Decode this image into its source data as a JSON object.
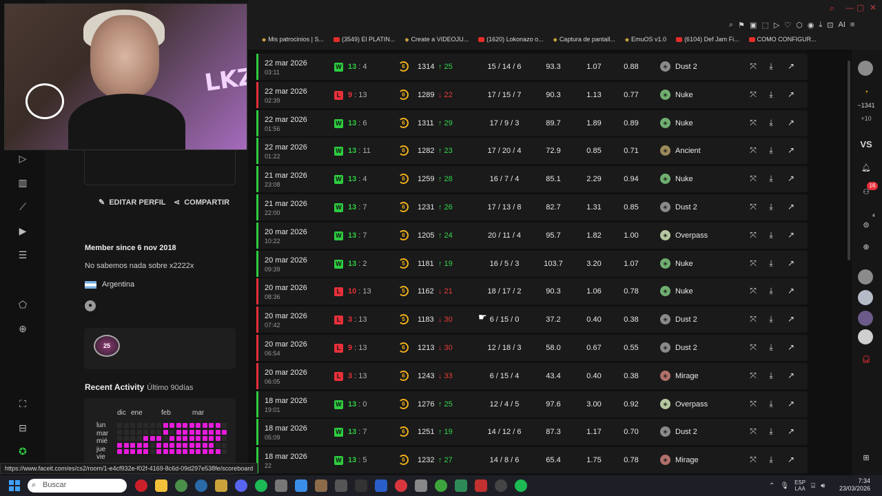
{
  "browser": {
    "bookmarks": [
      {
        "label": "Mis patrocinios | S...",
        "yt": false
      },
      {
        "label": "(3549) El PLATIN...",
        "yt": true
      },
      {
        "label": "Create a VIDEOJU...",
        "yt": false
      },
      {
        "label": "(1620) Lokonazo o...",
        "yt": true
      },
      {
        "label": "Captura de pantall...",
        "yt": false
      },
      {
        "label": "EmuOS v1.0",
        "yt": false
      },
      {
        "label": "(6104) Def Jam Fi...",
        "yt": true
      },
      {
        "label": "COMO CONFIGUR...",
        "yt": true
      }
    ],
    "ai_label": "AI",
    "status_url": "https://www.faceit.com/es/cs2/room/1-e4cf932e-f02f-4169-8c6d-09d297e538fe/scoreboard"
  },
  "profile": {
    "edit_label": "EDITAR PERFIL",
    "share_label": "COMPARTIR",
    "member_since": "Member since 6 nov 2018",
    "about": "No sabemos nada sobre x2222x",
    "country": "Argentina",
    "badge_text": "25",
    "recent_title": "Recent Activity",
    "recent_range": "Último 90días",
    "months": [
      "dic",
      "ene",
      "feb",
      "mar"
    ],
    "days": [
      "lun",
      "mar",
      "mié",
      "jue",
      "vie"
    ]
  },
  "webcam": {
    "wall_text": "LKZ"
  },
  "colors": {
    "win": "#2ecc40",
    "loss": "#e8303a",
    "up": "#33d94f",
    "down": "#ee3b3b",
    "level": "#f2b21a",
    "heat_on": "#e81bdc"
  },
  "matches": [
    {
      "date": "22 mar 2026",
      "time": "03:11",
      "result": "W",
      "score_a": "13",
      "score_b": "4",
      "level": "6",
      "elo": "1314",
      "delta": "↑ 25",
      "dir": "up",
      "kda": "15 / 14 / 6",
      "adr": "93.3",
      "kd": "1.07",
      "rating": "0.88",
      "map": "Dust 2"
    },
    {
      "date": "22 mar 2026",
      "time": "02:39",
      "result": "L",
      "score_a": "9",
      "score_b": "13",
      "level": "6",
      "elo": "1289",
      "delta": "↓ 22",
      "dir": "down",
      "kda": "17 / 15 / 7",
      "adr": "90.3",
      "kd": "1.13",
      "rating": "0.77",
      "map": "Nuke"
    },
    {
      "date": "22 mar 2026",
      "time": "01:56",
      "result": "W",
      "score_a": "13",
      "score_b": "6",
      "level": "6",
      "elo": "1311",
      "delta": "↑ 29",
      "dir": "up",
      "kda": "17 / 9 / 3",
      "adr": "89.7",
      "kd": "1.89",
      "rating": "0.89",
      "map": "Nuke"
    },
    {
      "date": "22 mar 2026",
      "time": "01:22",
      "result": "W",
      "score_a": "13",
      "score_b": "11",
      "level": "6",
      "elo": "1282",
      "delta": "↑ 23",
      "dir": "up",
      "kda": "17 / 20 / 4",
      "adr": "72.9",
      "kd": "0.85",
      "rating": "0.71",
      "map": "Ancient"
    },
    {
      "date": "21 mar 2026",
      "time": "23:08",
      "result": "W",
      "score_a": "13",
      "score_b": "4",
      "level": "6",
      "elo": "1259",
      "delta": "↑ 28",
      "dir": "up",
      "kda": "16 / 7 / 4",
      "adr": "85.1",
      "kd": "2.29",
      "rating": "0.94",
      "map": "Nuke"
    },
    {
      "date": "21 mar 2026",
      "time": "22:00",
      "result": "W",
      "score_a": "13",
      "score_b": "7",
      "level": "6",
      "elo": "1231",
      "delta": "↑ 26",
      "dir": "up",
      "kda": "17 / 13 / 8",
      "adr": "82.7",
      "kd": "1.31",
      "rating": "0.85",
      "map": "Dust 2"
    },
    {
      "date": "20 mar 2026",
      "time": "10:22",
      "result": "W",
      "score_a": "13",
      "score_b": "7",
      "level": "6",
      "elo": "1205",
      "delta": "↑ 24",
      "dir": "up",
      "kda": "20 / 11 / 4",
      "adr": "95.7",
      "kd": "1.82",
      "rating": "1.00",
      "map": "Overpass"
    },
    {
      "date": "20 mar 2026",
      "time": "09:39",
      "result": "W",
      "score_a": "13",
      "score_b": "2",
      "level": "5",
      "elo": "1181",
      "delta": "↑ 19",
      "dir": "up",
      "kda": "16 / 5 / 3",
      "adr": "103.7",
      "kd": "3.20",
      "rating": "1.07",
      "map": "Nuke"
    },
    {
      "date": "20 mar 2026",
      "time": "08:36",
      "result": "L",
      "score_a": "10",
      "score_b": "13",
      "level": "5",
      "elo": "1162",
      "delta": "↓ 21",
      "dir": "down",
      "kda": "18 / 17 / 2",
      "adr": "90.3",
      "kd": "1.06",
      "rating": "0.78",
      "map": "Nuke"
    },
    {
      "date": "20 mar 2026",
      "time": "07:42",
      "result": "L",
      "score_a": "3",
      "score_b": "13",
      "level": "5",
      "elo": "1183",
      "delta": "↓ 30",
      "dir": "down",
      "kda": "6 / 15 / 0",
      "adr": "37.2",
      "kd": "0.40",
      "rating": "0.38",
      "map": "Dust 2"
    },
    {
      "date": "20 mar 2026",
      "time": "06:54",
      "result": "L",
      "score_a": "9",
      "score_b": "13",
      "level": "6",
      "elo": "1213",
      "delta": "↓ 30",
      "dir": "down",
      "kda": "12 / 18 / 3",
      "adr": "58.0",
      "kd": "0.67",
      "rating": "0.55",
      "map": "Dust 2"
    },
    {
      "date": "20 mar 2026",
      "time": "06:05",
      "result": "L",
      "score_a": "3",
      "score_b": "13",
      "level": "6",
      "elo": "1243",
      "delta": "↓ 33",
      "dir": "down",
      "kda": "6 / 15 / 4",
      "adr": "43.4",
      "kd": "0.40",
      "rating": "0.38",
      "map": "Mirage"
    },
    {
      "date": "18 mar 2026",
      "time": "19:01",
      "result": "W",
      "score_a": "13",
      "score_b": "0",
      "level": "6",
      "elo": "1276",
      "delta": "↑ 25",
      "dir": "up",
      "kda": "12 / 4 / 5",
      "adr": "97.6",
      "kd": "3.00",
      "rating": "0.92",
      "map": "Overpass"
    },
    {
      "date": "18 mar 2026",
      "time": "05:09",
      "result": "W",
      "score_a": "13",
      "score_b": "7",
      "level": "6",
      "elo": "1251",
      "delta": "↑ 19",
      "dir": "up",
      "kda": "14 / 12 / 6",
      "adr": "87.3",
      "kd": "1.17",
      "rating": "0.70",
      "map": "Dust 2"
    },
    {
      "date": "18 mar 2026",
      "time": "22",
      "result": "W",
      "score_a": "13",
      "score_b": "5",
      "level": "6",
      "elo": "1232",
      "delta": "↑ 27",
      "dir": "up",
      "kda": "14 / 8 / 6",
      "adr": "65.4",
      "kd": "1.75",
      "rating": "0.78",
      "map": "Mirage"
    }
  ],
  "rightbar": {
    "elo_label": "~1341",
    "elo_diff": "+10",
    "vs_label": "VS",
    "notif_count": "16",
    "party_count": "4"
  },
  "taskbar": {
    "search_placeholder": "Buscar",
    "lang_line1": "ESP",
    "lang_line2": "LAA",
    "time": "7:34",
    "date": "23/03/2026"
  }
}
